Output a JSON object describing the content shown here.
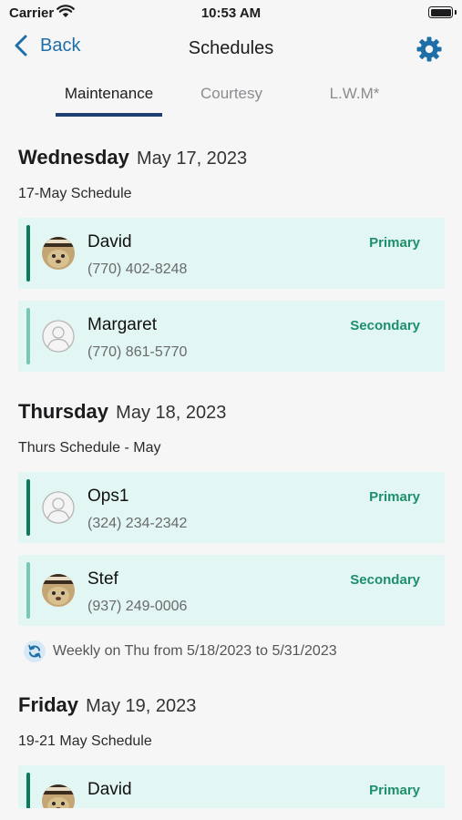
{
  "status_bar": {
    "carrier": "Carrier",
    "time": "10:53 AM"
  },
  "nav": {
    "back_label": "Back",
    "title": "Schedules"
  },
  "tabs": [
    {
      "label": "Maintenance",
      "active": true
    },
    {
      "label": "Courtesy",
      "active": false
    },
    {
      "label": "L.W.M*",
      "active": false
    }
  ],
  "days": [
    {
      "weekday": "Wednesday",
      "date": "May 17, 2023",
      "schedule_name": "17-May Schedule",
      "entries": [
        {
          "name": "David",
          "phone": "(770) 402-8248",
          "role": "Primary",
          "avatar": "photo"
        },
        {
          "name": "Margaret",
          "phone": "(770) 861-5770",
          "role": "Secondary",
          "avatar": "placeholder"
        }
      ]
    },
    {
      "weekday": "Thursday",
      "date": "May 18, 2023",
      "schedule_name": "Thurs Schedule - May",
      "entries": [
        {
          "name": "Ops1",
          "phone": "(324) 234-2342",
          "role": "Primary",
          "avatar": "placeholder"
        },
        {
          "name": "Stef",
          "phone": "(937) 249-0006",
          "role": "Secondary",
          "avatar": "photo"
        }
      ],
      "recurrence": "Weekly on Thu from 5/18/2023 to 5/31/2023"
    },
    {
      "weekday": "Friday",
      "date": "May 19, 2023",
      "schedule_name": "19-21 May Schedule",
      "entries": [
        {
          "name": "David",
          "phone": "",
          "role": "Primary",
          "avatar": "photo"
        }
      ]
    }
  ],
  "colors": {
    "accent": "#1e6fa8",
    "primary_role": "#1e8f6c",
    "card_bg": "#e2f6f3",
    "tab_underline": "#1d3f72"
  },
  "icons": {
    "back": "chevron-left-icon",
    "settings": "gear-icon",
    "recurrence": "refresh-icon",
    "avatar_placeholder": "person-icon"
  }
}
